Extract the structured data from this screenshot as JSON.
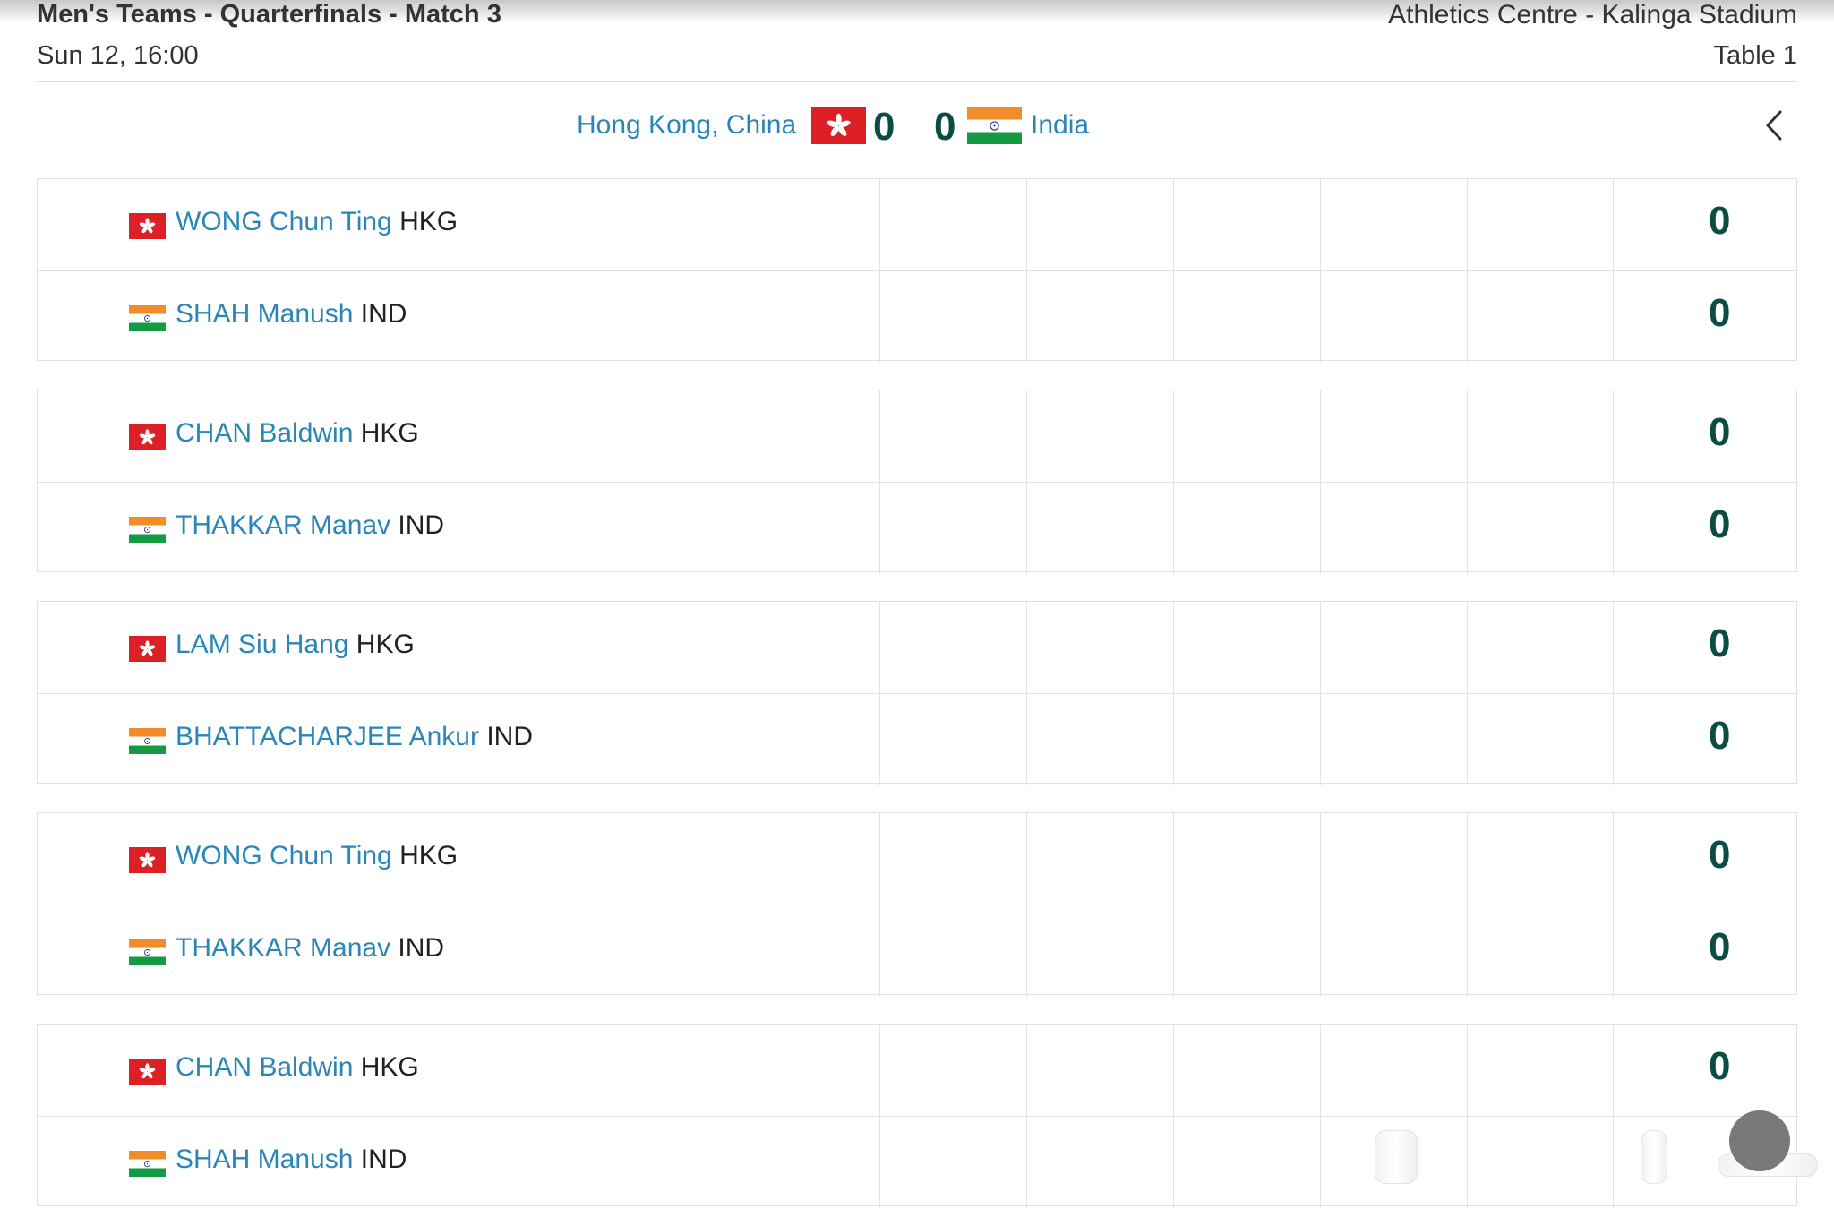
{
  "header": {
    "title": "Men's Teams - Quarterfinals - Match 3",
    "venue": "Athletics Centre - Kalinga Stadium",
    "datetime": "Sun 12, 16:00",
    "table": "Table 1"
  },
  "scoreline": {
    "home": {
      "name": "Hong Kong, China",
      "score": "0",
      "flag": "hong-kong-flag"
    },
    "away": {
      "name": "India",
      "score": "0",
      "flag": "india-flag"
    },
    "back_icon": "chevron-left-icon"
  },
  "colors": {
    "link": "#2b86b8",
    "score": "#0b4d42",
    "hk_red": "#dd1f26",
    "in_saffron": "#f28c28",
    "in_green": "#139a43"
  },
  "matches": [
    {
      "p1": {
        "name": "WONG Chun Ting",
        "code": "HKG",
        "score": "0"
      },
      "p2": {
        "name": "SHAH Manush",
        "code": "IND",
        "score": "0"
      }
    },
    {
      "p1": {
        "name": "CHAN Baldwin",
        "code": "HKG",
        "score": "0"
      },
      "p2": {
        "name": "THAKKAR Manav",
        "code": "IND",
        "score": "0"
      }
    },
    {
      "p1": {
        "name": "LAM Siu Hang",
        "code": "HKG",
        "score": "0"
      },
      "p2": {
        "name": "BHATTACHARJEE Ankur",
        "code": "IND",
        "score": "0"
      }
    },
    {
      "p1": {
        "name": "WONG Chun Ting",
        "code": "HKG",
        "score": "0"
      },
      "p2": {
        "name": "THAKKAR Manav",
        "code": "IND",
        "score": "0"
      }
    },
    {
      "p1": {
        "name": "CHAN Baldwin",
        "code": "HKG",
        "score": "0"
      },
      "p2": {
        "name": "SHAH Manush",
        "code": "IND",
        "score": null
      }
    }
  ]
}
